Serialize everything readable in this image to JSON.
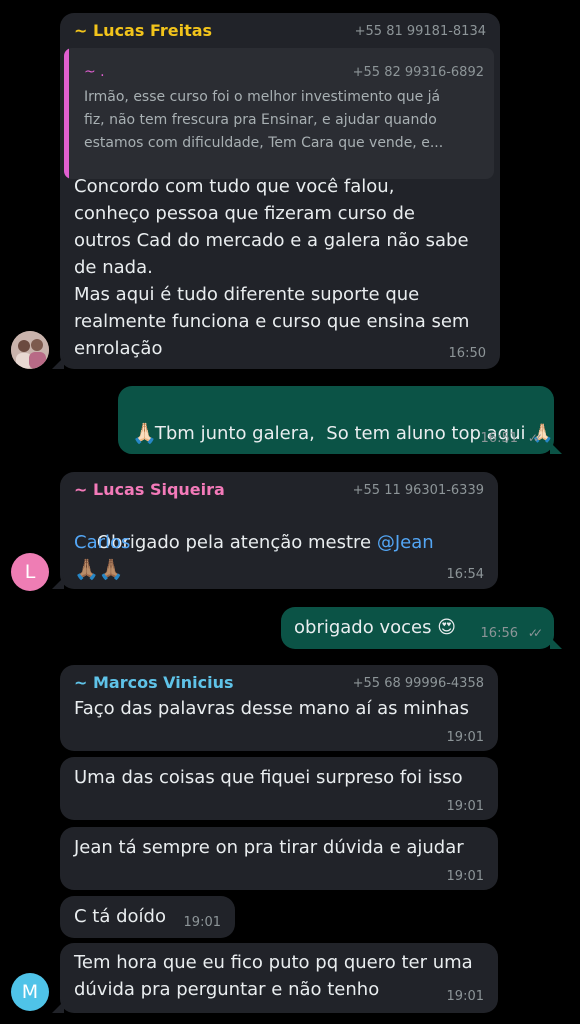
{
  "colors": {
    "background": "#000000",
    "incoming_bubble": "#212329",
    "outgoing_bubble": "#0b5346",
    "lucas_freitas": "#f2c41b",
    "lucas_siqueira": "#f37ab9",
    "marcos_vinicius": "#5fc3e8",
    "mention": "#53a6f5"
  },
  "messages": [
    {
      "sender": "~ Lucas Freitas",
      "phone": "+55 81 99181-8134",
      "quote": {
        "name": "~ .",
        "phone": "+55 82 99316-6892",
        "text_line1": "Irmão, esse curso foi o melhor investimento que já",
        "text_line2": "fiz, não tem frescura pra Ensinar, e ajudar quando",
        "text_line3": "estamos com dificuldade, Tem Cara que vende, e..."
      },
      "text_line1": "Concordo com tudo que você falou,",
      "text_line2": "conheço pessoa que fizeram curso de",
      "text_line3": "outros Cad do mercado e a galera não sabe",
      "text_line4": "de nada.",
      "text_line5": "Mas aqui é tudo diferente suporte que",
      "text_line6": "realmente funciona e curso que ensina sem",
      "text_line7": "enrolação",
      "time": "16:50"
    },
    {
      "text_line1": "Tbm junto galera,  So tem aluno top aqui 🙏🏻",
      "text_line2": "🙏🏻",
      "time": "16:51",
      "ticks": "✓✓"
    },
    {
      "sender": "~ Lucas Siqueira",
      "phone": "+55 11 96301-6339",
      "text_prefix": "Obrigado pela atenção mestre ",
      "mention_part1": "@Jean",
      "mention_part2": "Carlos",
      "emoji": "🙏🏽🙏🏽",
      "time": "16:54",
      "avatar_letter": "L"
    },
    {
      "text": "obrigado voces 😍",
      "time": "16:56",
      "ticks": "✓✓"
    },
    {
      "sender": "~ Marcos Vinicius",
      "phone": "+55 68 99996-4358",
      "text": "Faço das palavras desse mano aí as minhas",
      "time": "19:01"
    },
    {
      "text": "Uma das coisas que fiquei surpreso foi isso",
      "time": "19:01"
    },
    {
      "text": "Jean tá sempre on pra tirar dúvida e ajudar",
      "time": "19:01"
    },
    {
      "text": "C tá doído",
      "time": "19:01"
    },
    {
      "text_line1": "Tem hora que eu fico puto pq quero ter uma",
      "text_line2": "dúvida pra perguntar e não tenho",
      "time": "19:01",
      "avatar_letter": "M"
    }
  ]
}
